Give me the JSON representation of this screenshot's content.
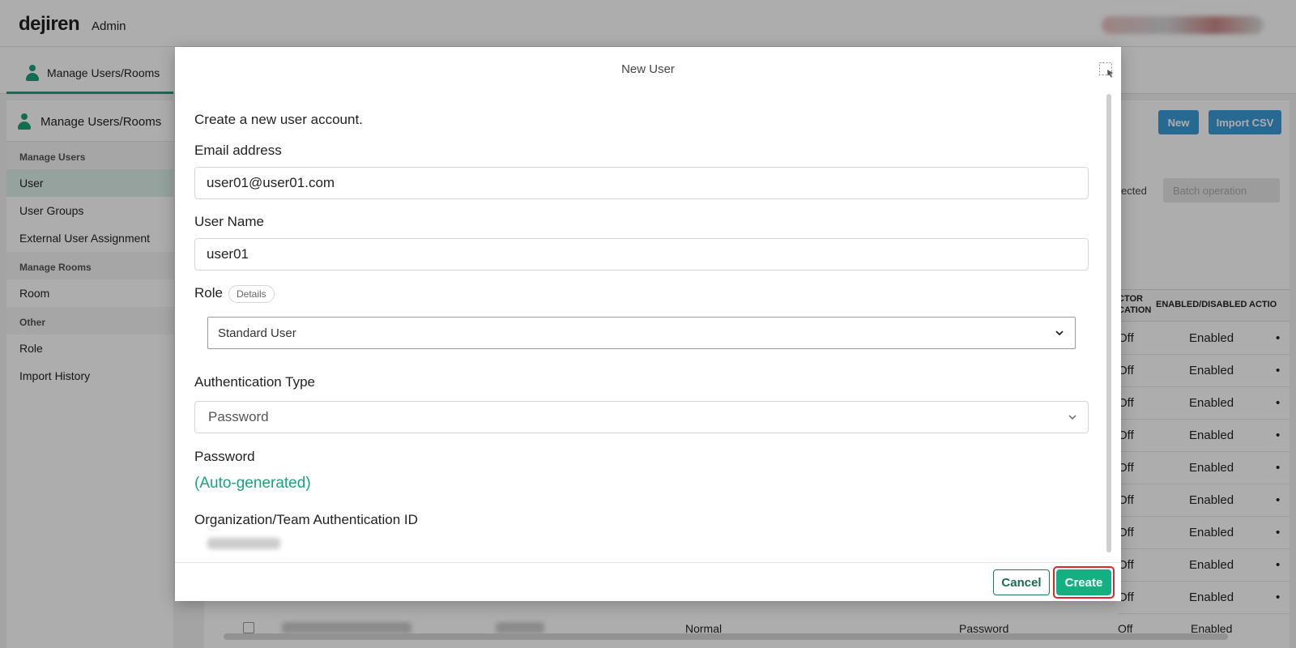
{
  "app": {
    "logo": "dejiren",
    "section": "Admin"
  },
  "tab": {
    "label": "Manage Users/Rooms"
  },
  "sidebar": {
    "title": "Manage Users/Rooms",
    "sections": [
      {
        "heading": "Manage Users",
        "items": [
          "User",
          "User Groups",
          "External User Assignment"
        ]
      },
      {
        "heading": "Manage Rooms",
        "items": [
          "Room"
        ]
      },
      {
        "heading": "Other",
        "items": [
          "Role",
          "Import History"
        ]
      }
    ],
    "active_item": "User"
  },
  "toolbar": {
    "new_label": "New",
    "import_label": "Import CSV",
    "selected_text": "ected",
    "batch_label": "Batch operation"
  },
  "table": {
    "headers": {
      "auth": "CTOR\nCATION",
      "enabled": "ENABLED/DISABLED",
      "action": "ACTIO"
    },
    "rows": [
      {
        "mfa": "Off",
        "status": "Enabled",
        "action": "•"
      },
      {
        "mfa": "Off",
        "status": "Enabled",
        "action": "•"
      },
      {
        "mfa": "Off",
        "status": "Enabled",
        "action": "•"
      },
      {
        "mfa": "Off",
        "status": "Enabled",
        "action": "•"
      },
      {
        "mfa": "Off",
        "status": "Enabled",
        "action": "•"
      },
      {
        "mfa": "Off",
        "status": "Enabled",
        "action": "•"
      },
      {
        "mfa": "Off",
        "status": "Enabled",
        "action": "•"
      },
      {
        "mfa": "Off",
        "status": "Enabled",
        "action": "•"
      },
      {
        "mfa": "Off",
        "status": "Enabled",
        "action": "•"
      }
    ],
    "bottom_row": {
      "type": "Normal",
      "auth": "Password",
      "mfa": "Off",
      "status": "Enabled"
    }
  },
  "modal": {
    "title": "New User",
    "intro": "Create a new user account.",
    "email": {
      "label": "Email address",
      "value": "user01@user01.com"
    },
    "username": {
      "label": "User Name",
      "value": "user01"
    },
    "role": {
      "label": "Role",
      "details": "Details",
      "value": "Standard User"
    },
    "auth_type": {
      "label": "Authentication Type",
      "value": "Password"
    },
    "password": {
      "label": "Password",
      "value": "(Auto-generated)"
    },
    "org_id": {
      "label": "Organization/Team Authentication ID"
    },
    "cancel_label": "Cancel",
    "create_label": "Create"
  },
  "colors": {
    "accent": "#14b082",
    "highlight": "#e0262a",
    "primary_blue": "#3b9bd6"
  }
}
